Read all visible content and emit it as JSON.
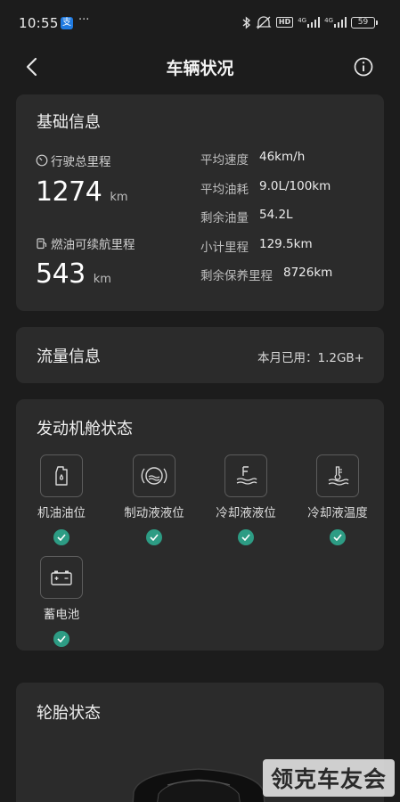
{
  "status_bar": {
    "time": "10:55",
    "alipay_glyph": "支",
    "dots": "···",
    "network_gen_1": "4G",
    "network_gen_2": "4G",
    "hd_label": "HD",
    "battery": "59"
  },
  "nav": {
    "title": "车辆状况"
  },
  "basic_info": {
    "title": "基础信息",
    "total_mileage_label": "行驶总里程",
    "total_mileage_value": "1274",
    "total_mileage_unit": "km",
    "range_label": "燃油可续航里程",
    "range_value": "543",
    "range_unit": "km",
    "stats": [
      {
        "label": "平均速度",
        "value": "46km/h"
      },
      {
        "label": "平均油耗",
        "value": "9.0L/100km"
      },
      {
        "label": "剩余油量",
        "value": "54.2L"
      },
      {
        "label": "小计里程",
        "value": "129.5km"
      },
      {
        "label": "剩余保养里程",
        "value": "8726km"
      }
    ]
  },
  "traffic": {
    "title": "流量信息",
    "usage": "本月已用：1.2GB+"
  },
  "engine": {
    "title": "发动机舱状态",
    "items": [
      {
        "label": "机油油位",
        "icon": "oil-can-icon",
        "status": "ok"
      },
      {
        "label": "制动液液位",
        "icon": "brake-fluid-icon",
        "status": "ok"
      },
      {
        "label": "冷却液液位",
        "icon": "coolant-level-icon",
        "status": "ok"
      },
      {
        "label": "冷却液温度",
        "icon": "coolant-temp-icon",
        "status": "ok"
      },
      {
        "label": "蓄电池",
        "icon": "battery-icon",
        "status": "ok"
      }
    ]
  },
  "tire": {
    "title": "轮胎状态"
  },
  "watermark": {
    "text": "领克车友会"
  },
  "colors": {
    "background": "#1c1c1c",
    "card": "#2b2b2b",
    "check_ok": "#2d9c84"
  }
}
